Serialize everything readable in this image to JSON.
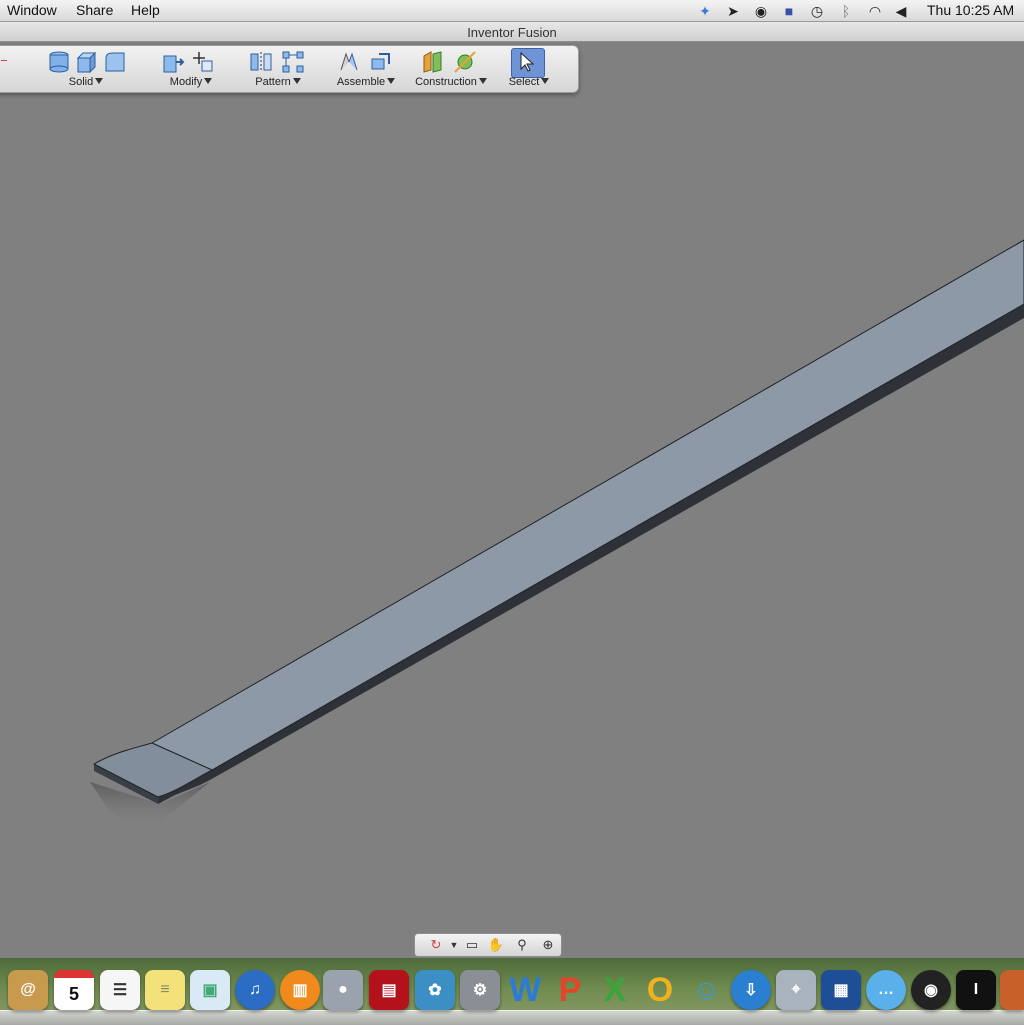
{
  "menubar": {
    "items": [
      "Window",
      "Share",
      "Help"
    ],
    "status_icons": [
      "dropbox-icon",
      "sync-icon",
      "shield-icon",
      "app-icon",
      "time-machine-icon",
      "bluetooth-icon",
      "wifi-icon",
      "volume-icon"
    ],
    "clock": "Thu 10:25 AM"
  },
  "window": {
    "title": "Inventor Fusion"
  },
  "toolbar": {
    "groups": [
      {
        "label": "Solid",
        "icons": [
          "cylinder-icon",
          "extrude-icon",
          "fillet-icon"
        ]
      },
      {
        "label": "Modify",
        "icons": [
          "press-pull-icon",
          "move-icon"
        ]
      },
      {
        "label": "Pattern",
        "icons": [
          "mirror-icon",
          "rectangular-pattern-icon"
        ]
      },
      {
        "label": "Assemble",
        "icons": [
          "constrain-icon",
          "joint-icon"
        ]
      },
      {
        "label": "Construction",
        "icons": [
          "plane-icon",
          "axis-icon"
        ]
      },
      {
        "label": "Select",
        "icons": [
          "pointer-icon"
        ]
      }
    ]
  },
  "navbar": {
    "icons": [
      "orbit-icon",
      "dropdown-icon",
      "look-at-icon",
      "pan-icon",
      "zoom-icon",
      "zoom-window-icon"
    ]
  },
  "colors": {
    "viewport": "#808080",
    "part_top": "#8d99a6",
    "part_edge": "#2e3238",
    "accent_select": "#6f94d6"
  },
  "dock": {
    "apps": [
      "address-book-icon",
      "calendar-icon",
      "reminders-icon",
      "stickies-icon",
      "preview-icon",
      "itunes-icon",
      "ibooks-icon",
      "facetime-icon",
      "photo-booth-icon",
      "iphoto-icon",
      "system-preferences-icon",
      "word-icon",
      "powerpoint-icon",
      "excel-icon",
      "outlook-icon",
      "messenger-icon",
      "downloader-icon",
      "network-icon",
      "remote-desktop-icon",
      "messages-icon",
      "camera-icon",
      "inventor-icon",
      "app-icon"
    ],
    "calendar_day": "5"
  }
}
